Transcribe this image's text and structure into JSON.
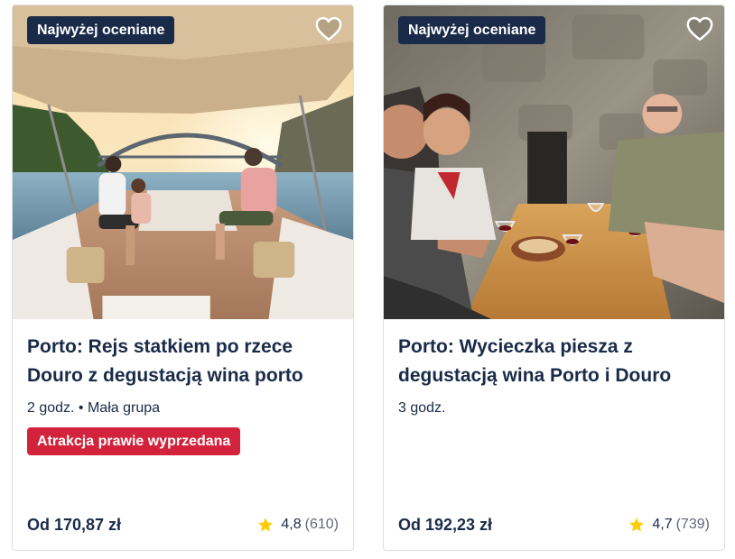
{
  "cards": [
    {
      "badge": "Najwyżej oceniane",
      "title": "Porto: Rejs statkiem po rzece Douro z degustacją wina porto",
      "meta": "2 godz. • Mała grupa",
      "alert": "Atrakcja prawie wyprzedana",
      "price": "Od 170,87 zł",
      "rating": "4,8",
      "reviews": "(610)",
      "photo": "boat-cruise-photo"
    },
    {
      "badge": "Najwyżej oceniane",
      "title": "Porto: Wycieczka piesza z degustacją wina Porto i Douro",
      "meta": "3 godz.",
      "price": "Od 192,23 zł",
      "rating": "4,7",
      "reviews": "(739)",
      "photo": "wine-tasting-photo"
    }
  ],
  "colors": {
    "badge_bg": "#1a2b49",
    "alert_bg": "#d3233c",
    "star": "#ffcc00",
    "text": "#1a2b49",
    "muted": "#63687a"
  }
}
